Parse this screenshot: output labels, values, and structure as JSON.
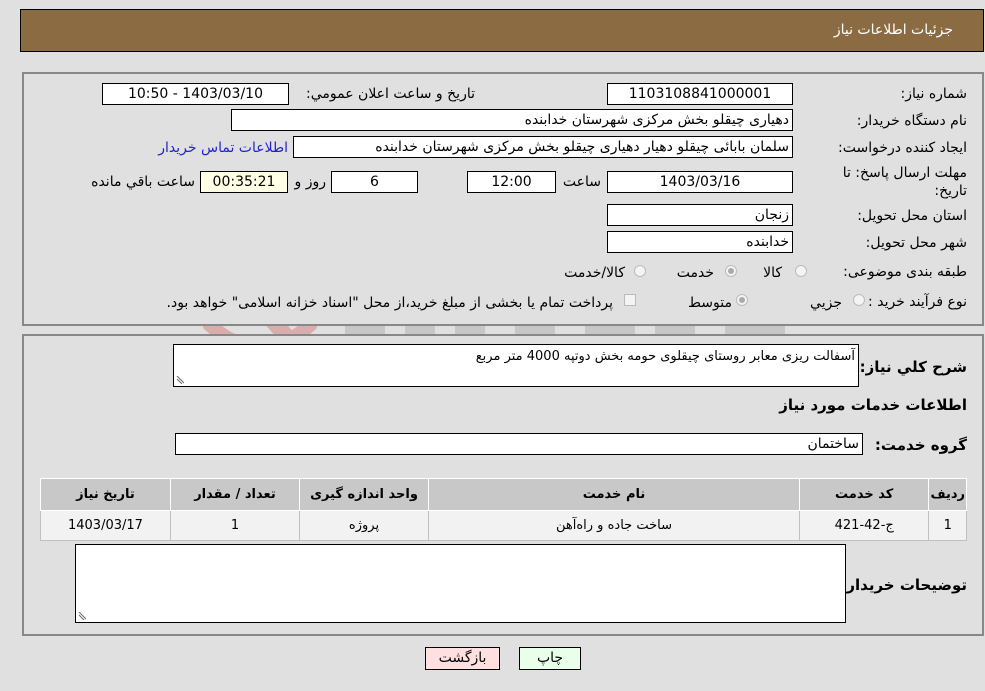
{
  "header": {
    "title": "جزئیات اطلاعات نیاز"
  },
  "form": {
    "need_number": {
      "label": "شماره نیاز:",
      "value": "1103108841000001"
    },
    "announce_datetime": {
      "label": "تاریخ و ساعت اعلان عمومي:",
      "value": "1403/03/10 - 10:50"
    },
    "buyer_org": {
      "label": "نام دستگاه خريدار:",
      "value": "دهیاری چیقلو بخش مرکزی شهرستان خدابنده"
    },
    "requester": {
      "label": "ایجاد کننده درخواست:",
      "value": "سلمان بابائی چیقلو دهیار دهیاری چیقلو بخش مرکزی شهرستان خدابنده"
    },
    "buyer_contact_link": "اطلاعات تماس خریدار",
    "deadline": {
      "label_line1": "مهلت ارسال پاسخ: تا",
      "label_line2": "تاریخ:",
      "date": "1403/03/16",
      "time_label": "ساعت",
      "time": "12:00",
      "days": "6",
      "days_label": "روز و",
      "remaining": "00:35:21",
      "remaining_label": "ساعت باقي مانده"
    },
    "province": {
      "label": "استان محل تحویل:",
      "value": "زنجان"
    },
    "city": {
      "label": "شهر محل تحویل:",
      "value": "خدابنده"
    },
    "category": {
      "label": "طبقه بندی موضوعی:",
      "options": [
        "کالا",
        "خدمت",
        "کالا/خدمت"
      ],
      "selected": "خدمت"
    },
    "purchase_type": {
      "label": "نوع فرآیند خرید :",
      "options": [
        "جزيي",
        "متوسط"
      ],
      "selected": "متوسط",
      "treasury_note": "پرداخت تمام یا بخشی از مبلغ خرید،از محل \"اسناد خزانه اسلامی\" خواهد بود."
    }
  },
  "description": {
    "label": "شرح کلي نياز:",
    "value": "آسفالت ریزی معابر روستای چیقلوی حومه بخش دوتپه 4000 متر مربع"
  },
  "services_section_title": "اطلاعات خدمات مورد نياز",
  "service_group": {
    "label": "گروه خدمت:",
    "value": "ساختمان"
  },
  "table": {
    "headers": [
      "رديف",
      "کد خدمت",
      "نام خدمت",
      "واحد اندازه گيری",
      "تعداد / مقدار",
      "تاريخ نياز"
    ],
    "rows": [
      [
        "1",
        "ج-42-421",
        "ساخت جاده و راه‌آهن",
        "پروژه",
        "1",
        "1403/03/17"
      ]
    ]
  },
  "buyer_notes": {
    "label": "توضيحات خريدار:",
    "value": ""
  },
  "buttons": {
    "print": "چاپ",
    "back": "بازگشت"
  },
  "colors": {
    "header_bg": "#8b6b42",
    "print_bg": "#eaffea",
    "back_bg": "#ffe0e0",
    "link": "#2222cc"
  }
}
